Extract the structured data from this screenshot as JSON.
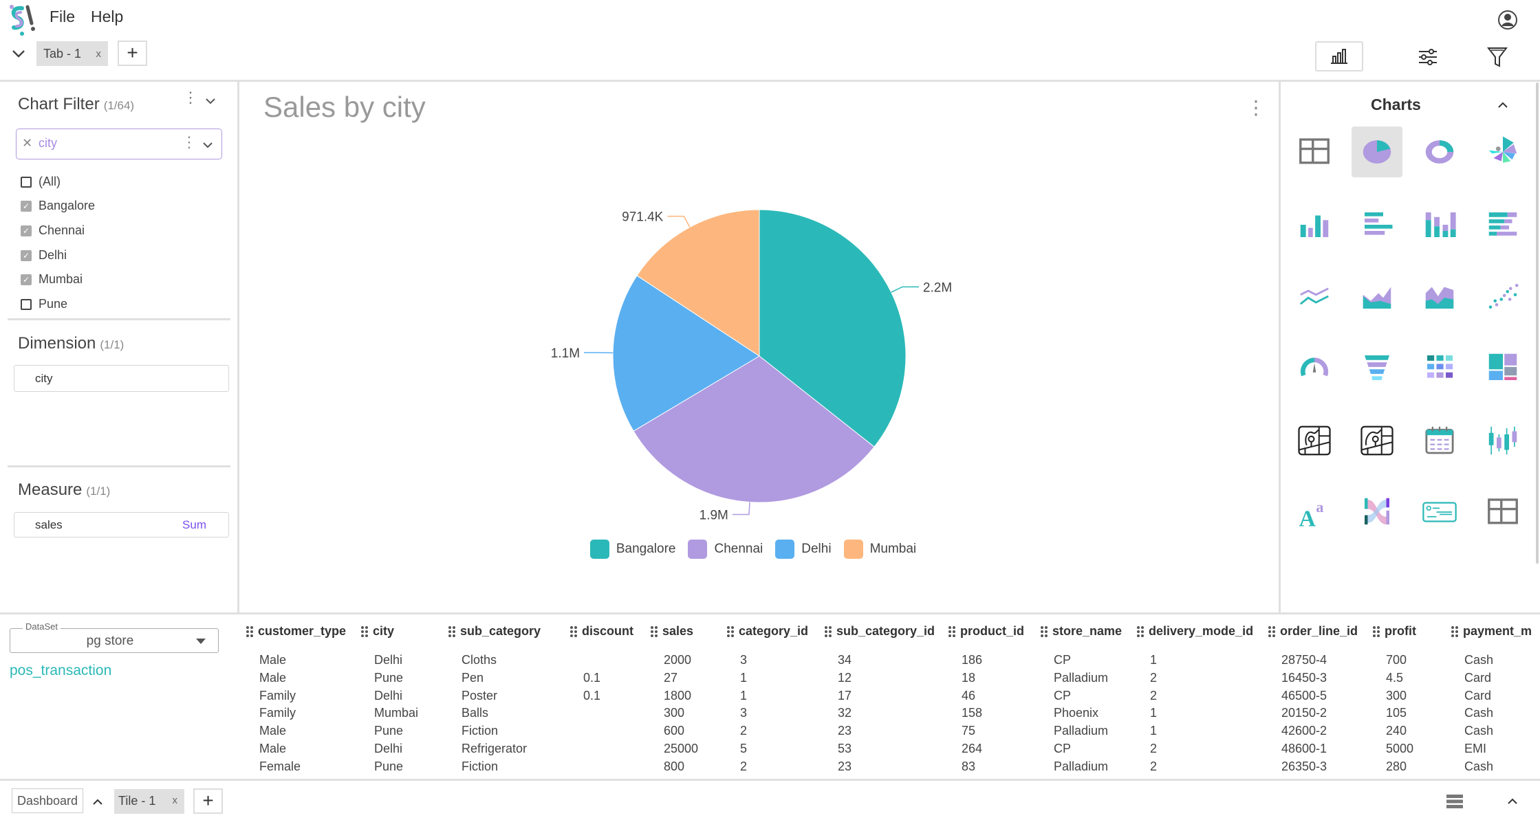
{
  "menu": {
    "file": "File",
    "help": "Help"
  },
  "tabs": [
    {
      "label": "Tab - 1",
      "close": "x"
    }
  ],
  "add_tab": "+",
  "chart_filter": {
    "title": "Chart Filter",
    "count": "(1/64)",
    "field": "city",
    "items": [
      {
        "label": "(All)",
        "checked": false
      },
      {
        "label": "Bangalore",
        "checked": true
      },
      {
        "label": "Chennai",
        "checked": true
      },
      {
        "label": "Delhi",
        "checked": true
      },
      {
        "label": "Mumbai",
        "checked": true
      },
      {
        "label": "Pune",
        "checked": false
      }
    ]
  },
  "dimension": {
    "title": "Dimension",
    "count": "(1/1)",
    "field": "city"
  },
  "measure": {
    "title": "Measure",
    "count": "(1/1)",
    "field": "sales",
    "aggregation": "Sum"
  },
  "chart_title": "Sales by city",
  "chart_data": {
    "type": "pie",
    "title": "Sales by city",
    "categories": [
      "Bangalore",
      "Chennai",
      "Delhi",
      "Mumbai"
    ],
    "values": [
      2200000,
      1900000,
      1100000,
      971400
    ],
    "data_labels": [
      "2.2M",
      "1.9M",
      "1.1M",
      "971.4K"
    ],
    "colors": [
      "#2bb8b8",
      "#b09ae0",
      "#5aaff0",
      "#fdb77e"
    ],
    "legend": "bottom"
  },
  "charts_panel": {
    "title": "Charts",
    "icons": [
      "table",
      "pie",
      "donut",
      "rose",
      "bar",
      "hbar",
      "stacked-bar",
      "stacked-hbar",
      "line",
      "area",
      "stacked-area",
      "scatter",
      "gauge",
      "funnel",
      "heatmap",
      "treemap",
      "map",
      "map-alt",
      "calendar",
      "candlestick",
      "text",
      "sankey",
      "card",
      "pivot-table"
    ],
    "selected": "pie"
  },
  "dataset": {
    "label": "DataSet",
    "value": "pg store",
    "table": "pos_transaction"
  },
  "table": {
    "columns": [
      "customer_type",
      "city",
      "sub_category",
      "discount",
      "sales",
      "category_id",
      "sub_category_id",
      "product_id",
      "store_name",
      "delivery_mode_id",
      "order_line_id",
      "profit",
      "payment_m"
    ],
    "rows": [
      [
        "Male",
        "Delhi",
        "Cloths",
        "",
        "2000",
        "3",
        "34",
        "186",
        "CP",
        "1",
        "28750-4",
        "700",
        "Cash"
      ],
      [
        "Male",
        "Pune",
        "Pen",
        "0.1",
        "27",
        "1",
        "12",
        "18",
        "Palladium",
        "2",
        "16450-3",
        "4.5",
        "Card"
      ],
      [
        "Family",
        "Delhi",
        "Poster",
        "0.1",
        "1800",
        "1",
        "17",
        "46",
        "CP",
        "2",
        "46500-5",
        "300",
        "Card"
      ],
      [
        "Family",
        "Mumbai",
        "Balls",
        "",
        "300",
        "3",
        "32",
        "158",
        "Phoenix",
        "1",
        "20150-2",
        "105",
        "Cash"
      ],
      [
        "Male",
        "Pune",
        "Fiction",
        "",
        "600",
        "2",
        "23",
        "75",
        "Palladium",
        "1",
        "42600-2",
        "240",
        "Cash"
      ],
      [
        "Male",
        "Delhi",
        "Refrigerator",
        "",
        "25000",
        "5",
        "53",
        "264",
        "CP",
        "2",
        "48600-1",
        "5000",
        "EMI"
      ],
      [
        "Female",
        "Pune",
        "Fiction",
        "",
        "800",
        "2",
        "23",
        "83",
        "Palladium",
        "2",
        "26350-3",
        "280",
        "Cash"
      ]
    ]
  },
  "bottom": {
    "dashboard": "Dashboard",
    "tile": "Tile - 1",
    "tile_close": "x",
    "add_tile": "+"
  }
}
